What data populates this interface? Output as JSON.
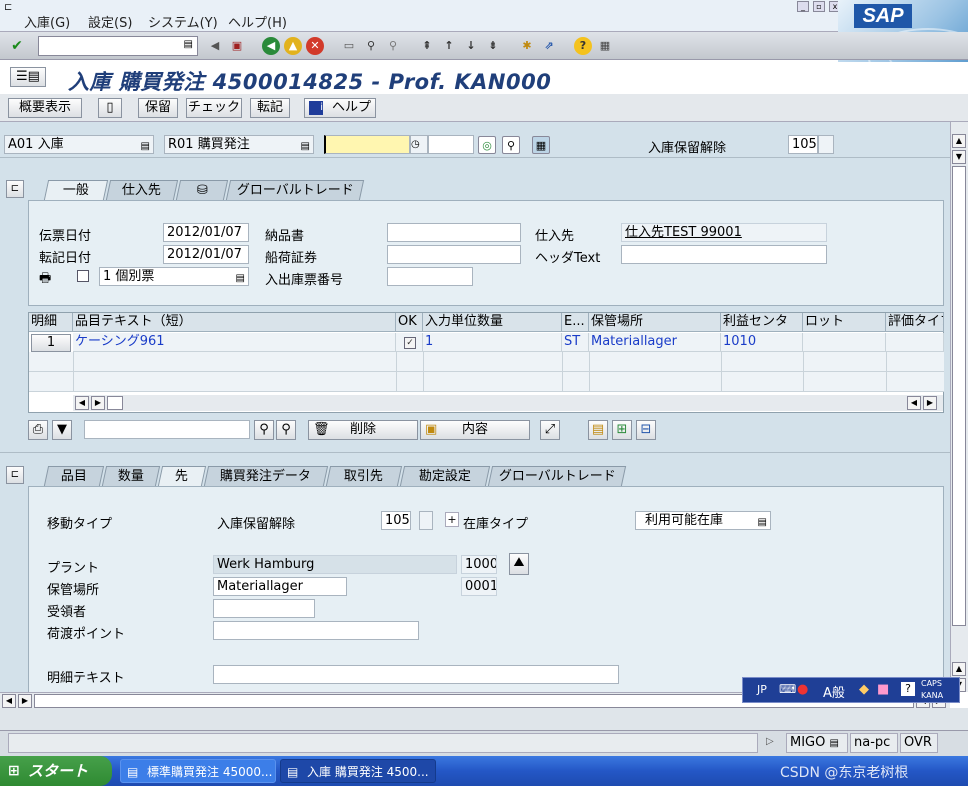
{
  "menu": [
    "入庫(G)",
    "設定(S)",
    "システム(Y)",
    "ヘルプ(H)"
  ],
  "logo": "SAP",
  "title": "入庫 購買発注 4500014825 - Prof. KAN000",
  "app_buttons": {
    "overview": "概要表示",
    "save": "保留",
    "check": "チェック",
    "post": "転記",
    "help": "ヘルプ"
  },
  "header": {
    "action": "A01 入庫",
    "ref": "R01 購買発注",
    "movement_label": "入庫保留解除",
    "movement_value": "105"
  },
  "tabs_top": [
    "一般",
    "仕入先",
    "",
    "グローバルトレード"
  ],
  "general": {
    "doc_date_label": "伝票日付",
    "doc_date": "2012/01/07",
    "post_date_label": "転記日付",
    "post_date": "2012/01/07",
    "delivery_note_label": "納品書",
    "bill_label": "船荷証券",
    "gr_slip_label": "入出庫票番号",
    "vendor_label": "仕入先",
    "vendor_value": "仕入先TEST 99001",
    "header_text_label": "ヘッダText",
    "print_option": "1 個別票"
  },
  "grid": {
    "headers": [
      "明細",
      "品目テキスト（短）",
      "OK",
      "入力単位数量",
      "E...",
      "保管場所",
      "利益センタ",
      "ロット",
      "評価タイプ"
    ],
    "row": {
      "line": "1",
      "text": "ケーシング961",
      "qty": "1",
      "unit": "ST",
      "sloc": "Materiallager",
      "profit": "1010"
    }
  },
  "grid_buttons": {
    "delete": "削除",
    "contents": "内容"
  },
  "tabs_bottom": [
    "品目",
    "数量",
    "先",
    "購買発注データ",
    "取引先",
    "勘定設定",
    "グローバルトレード"
  ],
  "detail": {
    "mvt_type_label": "移動タイプ",
    "mvt_text": "入庫保留解除",
    "mvt_code": "105",
    "stock_type_label": "在庫タイプ",
    "stock_type": "利用可能在庫",
    "plant_label": "プラント",
    "plant_name": "Werk Hamburg",
    "plant_code": "1000",
    "sloc_label": "保管場所",
    "sloc_name": "Materiallager",
    "sloc_code": "0001",
    "recipient_label": "受領者",
    "unloading_label": "荷渡ポイント",
    "item_text_label": "明細テキスト"
  },
  "status": {
    "tcode": "MIGO",
    "server": "na-pc",
    "mode": "OVR"
  },
  "taskbar": {
    "start": "スタート",
    "task1": "標準購買発注 45000...",
    "task2": "入庫 購買発注 4500...",
    "watermark": "CSDN @东京老树根"
  },
  "ime": {
    "lang": "JP",
    "mode": "A般",
    "caps": "CAPS",
    "kana": "KANA"
  }
}
